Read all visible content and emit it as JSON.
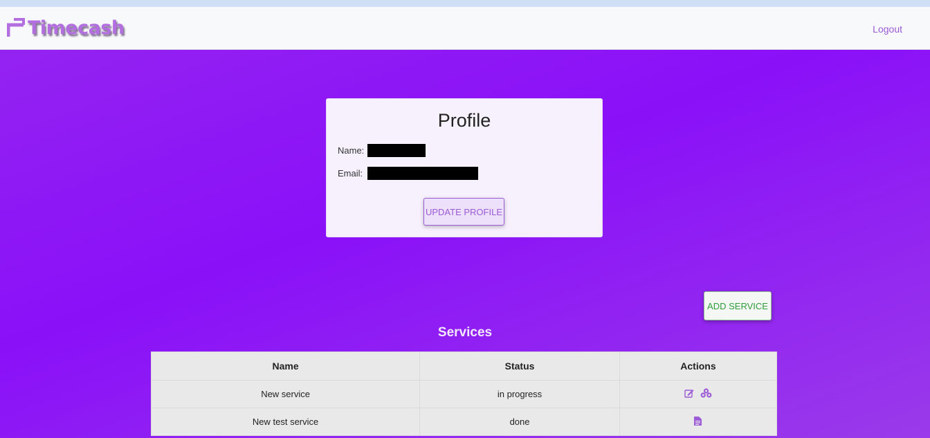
{
  "app": {
    "brand": "Timecash",
    "logout_label": "Logout"
  },
  "profile": {
    "title": "Profile",
    "name_label": "Name:",
    "email_label": "Email:",
    "update_label": "UPDATE PROFILE"
  },
  "services": {
    "add_label": "ADD SERVICE",
    "title": "Services",
    "columns": {
      "name": "Name",
      "status": "Status",
      "actions": "Actions"
    },
    "rows": [
      {
        "name": "New service",
        "status": "in progress",
        "actions": [
          "edit-icon",
          "cubes-icon"
        ]
      },
      {
        "name": "New test service",
        "status": "done",
        "actions": [
          "file-icon"
        ]
      }
    ]
  },
  "colors": {
    "accent": "#9b5ad6",
    "background": "#8a10f8",
    "success": "#2e9c3a"
  }
}
